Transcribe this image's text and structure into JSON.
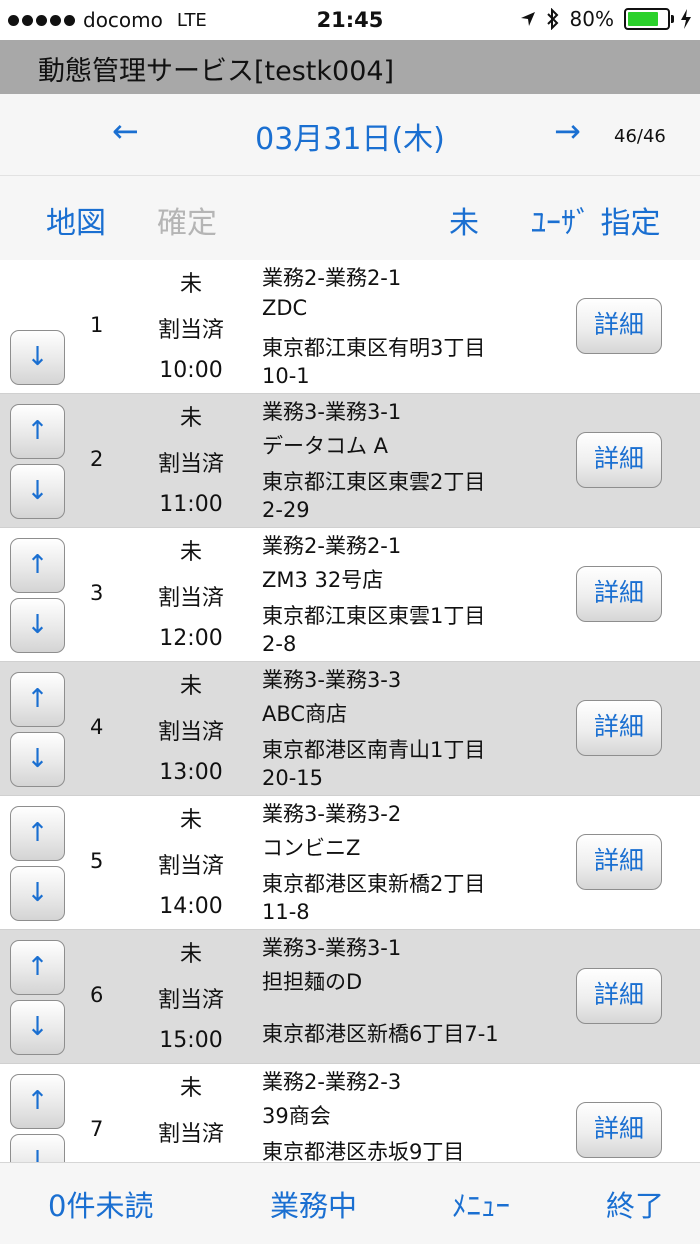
{
  "status_bar": {
    "carrier": "docomo",
    "network": "LTE",
    "time": "21:45",
    "battery": "80%",
    "battery_level": 0.8,
    "location_icon": "location-arrow-icon",
    "bluetooth_icon": "bluetooth-icon",
    "charging_icon": "charging-bolt-icon"
  },
  "header": {
    "title": "動態管理サービス[testk004]"
  },
  "date_nav": {
    "prev": "←",
    "date": "03月31日(木)",
    "next": "→",
    "page": "46/46"
  },
  "actions": {
    "map": "地図",
    "confirm": "確定",
    "unassigned": "未",
    "user_assign": "ﾕｰｻﾞ 指定"
  },
  "list": {
    "up_label": "↑",
    "down_label": "↓",
    "detail_label": "詳細",
    "rows": [
      {
        "no": "1",
        "status1": "未",
        "status2": "割当済",
        "time": "10:00",
        "task": "業務2-業務2-1",
        "name": "ZDC",
        "address": "東京都江東区有明3丁目",
        "address2": "10-1"
      },
      {
        "no": "2",
        "status1": "未",
        "status2": "割当済",
        "time": "11:00",
        "task": "業務3-業務3-1",
        "name": "データコム A",
        "address": "東京都江東区東雲2丁目",
        "address2": "2-29"
      },
      {
        "no": "3",
        "status1": "未",
        "status2": "割当済",
        "time": "12:00",
        "task": "業務2-業務2-1",
        "name": "ZM3 32号店",
        "address": "東京都江東区東雲1丁目",
        "address2": "2-8"
      },
      {
        "no": "4",
        "status1": "未",
        "status2": "割当済",
        "time": "13:00",
        "task": "業務3-業務3-3",
        "name": "ABC商店",
        "address": "東京都港区南青山1丁目",
        "address2": "20-15"
      },
      {
        "no": "5",
        "status1": "未",
        "status2": "割当済",
        "time": "14:00",
        "task": "業務3-業務3-2",
        "name": "コンビニZ",
        "address": "東京都港区東新橋2丁目",
        "address2": "11-8"
      },
      {
        "no": "6",
        "status1": "未",
        "status2": "割当済",
        "time": "15:00",
        "task": "業務3-業務3-1",
        "name": "担担麺のD",
        "address": "東京都港区新橋6丁目7-1",
        "address2": ""
      },
      {
        "no": "7",
        "status1": "未",
        "status2": "割当済",
        "time": "",
        "task": "業務2-業務2-3",
        "name": "39商会",
        "address": "東京都港区赤坂9丁目",
        "address2": ""
      }
    ]
  },
  "tab_bar": {
    "unread": "0件未読",
    "working": "業務中",
    "menu": "ﾒﾆｭｰ",
    "quit": "終了"
  },
  "colors": {
    "accent": "#1a6fd1",
    "title_bar": "#a8a8a8",
    "row_alt": "#dcdcdc",
    "battery": "#2bd12b"
  }
}
